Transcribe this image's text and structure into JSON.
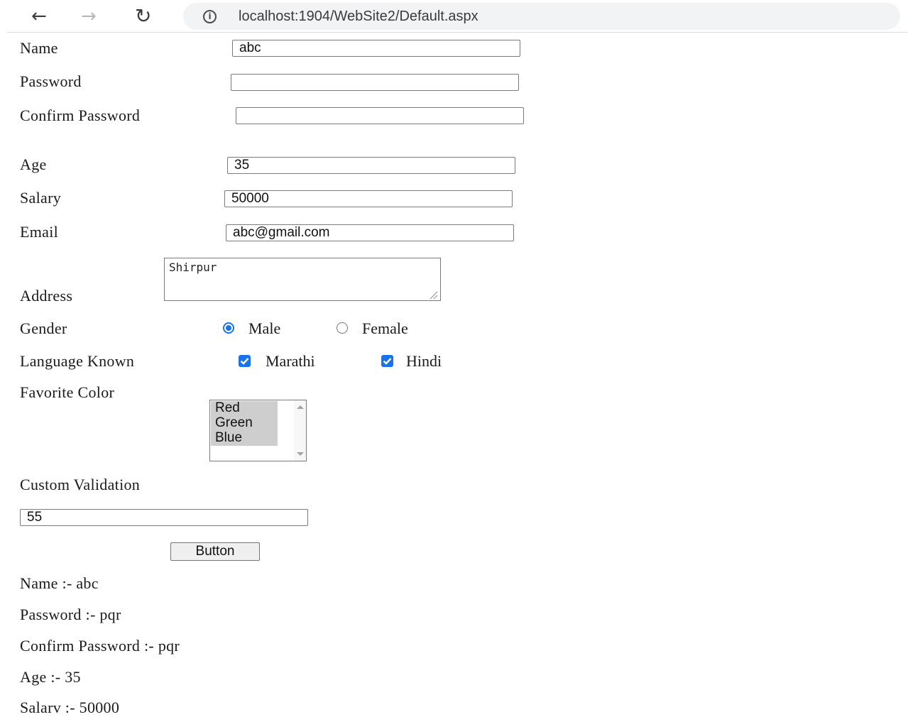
{
  "browser": {
    "url": "localhost:1904/WebSite2/Default.aspx"
  },
  "form": {
    "name_label": "Name",
    "name_value": "abc",
    "password_label": "Password",
    "password_value": "",
    "confirm_password_label": "Confirm Password",
    "confirm_password_value": "",
    "age_label": "Age",
    "age_value": "35",
    "salary_label": "Salary",
    "salary_value": "50000",
    "email_label": "Email",
    "email_value": "abc@gmail.com",
    "address_label": "Address",
    "address_value": "Shirpur",
    "gender_label": "Gender",
    "gender_options": [
      {
        "label": "Male",
        "selected": true
      },
      {
        "label": "Female",
        "selected": false
      }
    ],
    "language_label": "Language Known",
    "language_options": [
      {
        "label": "Marathi",
        "checked": true
      },
      {
        "label": "Hindi",
        "checked": true
      }
    ],
    "favorite_color_label": "Favorite Color",
    "color_options": [
      "Red",
      "Green",
      "Blue"
    ],
    "custom_validation_label": "Custom Validation",
    "custom_validation_value": "55",
    "button_label": "Button"
  },
  "output": {
    "name_line": "Name :- abc",
    "password_line": "Password :- pqr",
    "confirm_password_line": "Confirm Password :- pqr",
    "age_line": "Age :- 35",
    "salary_line": "Salarv :- 50000"
  },
  "colors": {
    "accent": "#1a73e8",
    "listbox_selected": "#cecece",
    "omnibox_bg": "#f1f3f4"
  }
}
